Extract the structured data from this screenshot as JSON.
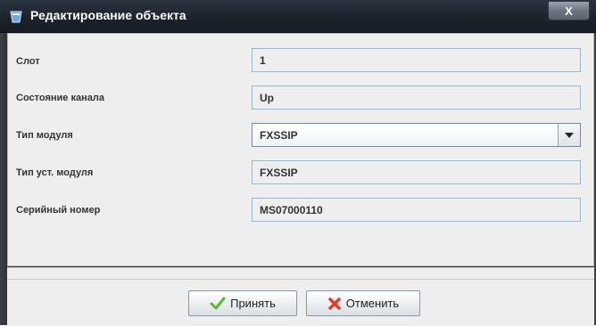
{
  "window": {
    "title": "Редактирование объекта",
    "close_label": "X"
  },
  "form": {
    "rows": [
      {
        "label": "Слот",
        "value": "1"
      },
      {
        "label": "Состояние канала",
        "value": "Up"
      },
      {
        "label": "Тип модуля",
        "value": "FXSSIP"
      },
      {
        "label": "Тип уст. модуля",
        "value": "FXSSIP"
      },
      {
        "label": "Серийный номер",
        "value": "MS07000110"
      }
    ]
  },
  "buttons": {
    "accept_label": "Принять",
    "cancel_label": "Отменить"
  },
  "colors": {
    "titlebar": "#1c232c",
    "panel_bg": "#eeeeee",
    "field_border": "#9fb7c4",
    "accept_icon": "#5fb83a",
    "cancel_icon": "#e23b2e"
  },
  "icons": {
    "app": "app-window-icon",
    "accept": "checkmark-icon",
    "cancel": "x-cross-icon",
    "select": "chevron-down-icon"
  }
}
